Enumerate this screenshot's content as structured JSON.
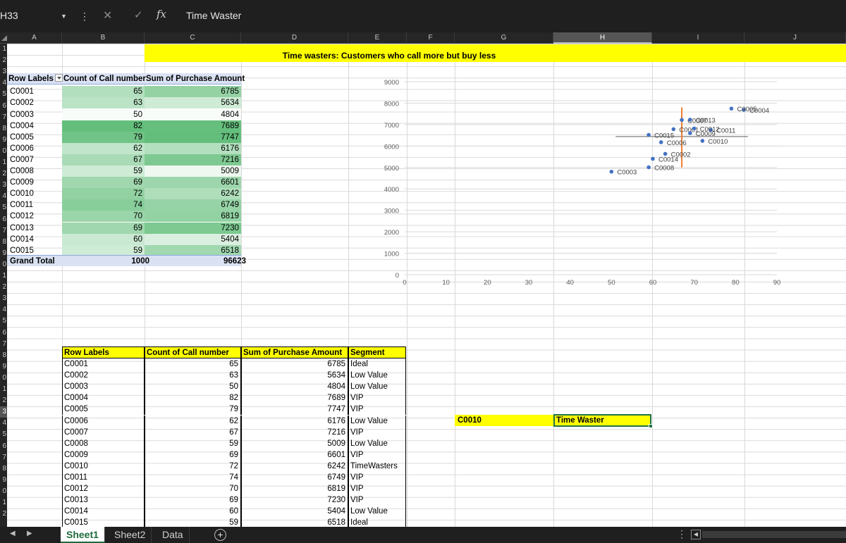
{
  "formula_bar": {
    "name_box": "H33",
    "dots": "⋮",
    "cancel": "✕",
    "enter": "✓",
    "fx": "fx",
    "value": "Time Waster"
  },
  "columns": [
    "A",
    "B",
    "C",
    "D",
    "E",
    "F",
    "G",
    "H",
    "I",
    "J"
  ],
  "rows": [
    "1",
    "2",
    "3",
    "4",
    "5",
    "6",
    "7",
    "8",
    "9",
    "0",
    "1",
    "2",
    "3",
    "4",
    "5",
    "6",
    "7",
    "8",
    "9",
    "0",
    "1",
    "2",
    "3",
    "4",
    "5",
    "6",
    "7",
    "8",
    "9",
    "0",
    "1",
    "2",
    "3",
    "4",
    "5",
    "6",
    "7",
    "8",
    "9",
    "0",
    "1",
    "2"
  ],
  "banner": "Time wasters: Customers who call more but buy less",
  "pivot1": {
    "headers": [
      "Row Labels",
      "Count of Call number",
      "Sum of Purchase Amount"
    ],
    "rows": [
      [
        "C0001",
        "65",
        "6785"
      ],
      [
        "C0002",
        "63",
        "5634"
      ],
      [
        "C0003",
        "50",
        "4804"
      ],
      [
        "C0004",
        "82",
        "7689"
      ],
      [
        "C0005",
        "79",
        "7747"
      ],
      [
        "C0006",
        "62",
        "6176"
      ],
      [
        "C0007",
        "67",
        "7216"
      ],
      [
        "C0008",
        "59",
        "5009"
      ],
      [
        "C0009",
        "69",
        "6601"
      ],
      [
        "C0010",
        "72",
        "6242"
      ],
      [
        "C0011",
        "74",
        "6749"
      ],
      [
        "C0012",
        "70",
        "6819"
      ],
      [
        "C0013",
        "69",
        "7230"
      ],
      [
        "C0014",
        "60",
        "5404"
      ],
      [
        "C0015",
        "59",
        "6518"
      ]
    ],
    "total": [
      "Grand Total",
      "1000",
      "96623"
    ]
  },
  "pivot2": {
    "headers": [
      "Row Labels",
      "Count of Call number",
      "Sum of Purchase Amount",
      "Segment"
    ],
    "rows": [
      [
        "C0001",
        "65",
        "6785",
        "Ideal"
      ],
      [
        "C0002",
        "63",
        "5634",
        "Low Value"
      ],
      [
        "C0003",
        "50",
        "4804",
        "Low Value"
      ],
      [
        "C0004",
        "82",
        "7689",
        "VIP"
      ],
      [
        "C0005",
        "79",
        "7747",
        "VIP"
      ],
      [
        "C0006",
        "62",
        "6176",
        "Low Value"
      ],
      [
        "C0007",
        "67",
        "7216",
        "VIP"
      ],
      [
        "C0008",
        "59",
        "5009",
        "Low Value"
      ],
      [
        "C0009",
        "69",
        "6601",
        "VIP"
      ],
      [
        "C0010",
        "72",
        "6242",
        "TimeWasters"
      ],
      [
        "C0011",
        "74",
        "6749",
        "VIP"
      ],
      [
        "C0012",
        "70",
        "6819",
        "VIP"
      ],
      [
        "C0013",
        "69",
        "7230",
        "VIP"
      ],
      [
        "C0014",
        "60",
        "5404",
        "Low Value"
      ],
      [
        "C0015",
        "59",
        "6518",
        "Ideal"
      ]
    ]
  },
  "selected": {
    "customer": "C0010",
    "result": "Time Waster"
  },
  "tabs": [
    "Sheet1",
    "Sheet2",
    "Data"
  ],
  "tabs_overflow": "⋮",
  "colors": {
    "banner": "#ffff00",
    "pivot_header": "#d9e1f2",
    "point": "#4472c4",
    "avg_v": "#ed7d31",
    "avg_h": "#7f7f7f",
    "selection": "#217346",
    "heat_low": "#f8fcf9",
    "heat_high": "#63be7b"
  },
  "chart_data": {
    "type": "scatter",
    "title": "",
    "xlabel": "",
    "ylabel": "",
    "xlim": [
      0,
      90
    ],
    "ylim": [
      0,
      9000
    ],
    "xticks": [
      0,
      10,
      20,
      30,
      40,
      50,
      60,
      70,
      80,
      90
    ],
    "yticks": [
      0,
      1000,
      2000,
      3000,
      4000,
      5000,
      6000,
      7000,
      8000,
      9000
    ],
    "grid": true,
    "points": [
      {
        "label": "C0001",
        "x": 65,
        "y": 6785
      },
      {
        "label": "C0002",
        "x": 63,
        "y": 5634
      },
      {
        "label": "C0003",
        "x": 50,
        "y": 4804
      },
      {
        "label": "C0004",
        "x": 82,
        "y": 7689
      },
      {
        "label": "C0005",
        "x": 79,
        "y": 7747
      },
      {
        "label": "C0006",
        "x": 62,
        "y": 6176
      },
      {
        "label": "C0007",
        "x": 67,
        "y": 7216
      },
      {
        "label": "C0008",
        "x": 59,
        "y": 5009
      },
      {
        "label": "C0009",
        "x": 69,
        "y": 6601
      },
      {
        "label": "C0010",
        "x": 72,
        "y": 6242
      },
      {
        "label": "C0011",
        "x": 74,
        "y": 6749
      },
      {
        "label": "C0012",
        "x": 70,
        "y": 6819
      },
      {
        "label": "C0013",
        "x": 69,
        "y": 7230
      },
      {
        "label": "C0014",
        "x": 60,
        "y": 5404
      },
      {
        "label": "C0015",
        "x": 59,
        "y": 6518
      }
    ],
    "avg_line_x": {
      "x": 67,
      "y_from": 5000,
      "y_to": 7800
    },
    "avg_line_y": {
      "y": 6442,
      "x_from": 51,
      "x_to": 83
    }
  }
}
